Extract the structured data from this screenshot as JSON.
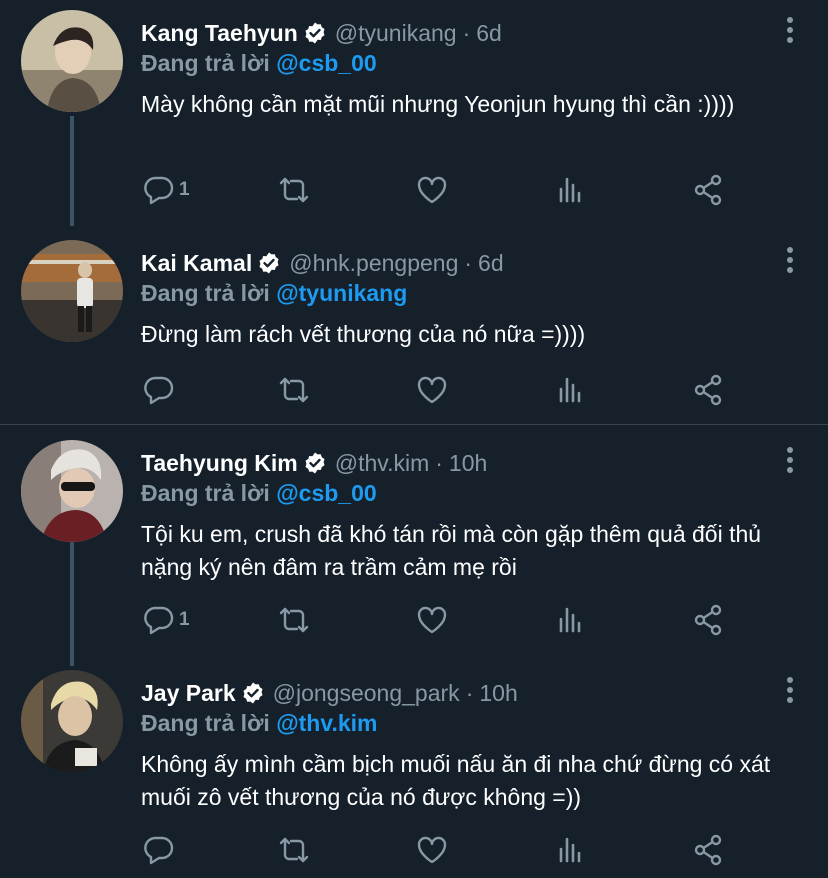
{
  "reply_prefix": "Đang trả lời",
  "tweets": [
    {
      "name": "Kang Taehyun",
      "handle": "@tyunikang",
      "time": "6d",
      "reply_to": "@csb_00",
      "text": "Mày không cần mặt mũi nhưng Yeonjun hyung thì cần :))))",
      "reply_count": "1",
      "avatar_bg": "#c9bfa6"
    },
    {
      "name": "Kai Kamal",
      "handle": "@hnk.pengpeng",
      "time": "6d",
      "reply_to": "@tyunikang",
      "text": "Đừng làm rách vết thương của nó nữa =))))",
      "reply_count": "",
      "avatar_bg": "#7b6a55"
    },
    {
      "name": "Taehyung Kim",
      "handle": "@thv.kim",
      "time": "10h",
      "reply_to": "@csb_00",
      "text": "Tội ku em, crush đã khó tán rồi mà còn gặp thêm quả đối thủ nặng ký nên đâm ra trầm cảm mẹ rồi",
      "reply_count": "1",
      "avatar_bg": "#b9b2ae"
    },
    {
      "name": "Jay Park",
      "handle": "@jongseong_park",
      "time": "10h",
      "reply_to": "@thv.kim",
      "text": "Không ấy mình cầm bịch muối nấu ăn đi nha chứ đừng có xát muối zô vết thương của nó được không =))",
      "reply_count": "",
      "avatar_bg": "#3c3a36"
    }
  ],
  "colors": {
    "background": "#15202b",
    "text": "#ffffff",
    "secondary": "#8899a6",
    "link": "#1d9bf0",
    "divider": "#38444d",
    "thread_line": "#3d5466"
  },
  "icons": [
    "more-icon",
    "verified-badge-icon",
    "reply-icon",
    "retweet-icon",
    "like-icon",
    "analytics-icon",
    "share-icon"
  ]
}
